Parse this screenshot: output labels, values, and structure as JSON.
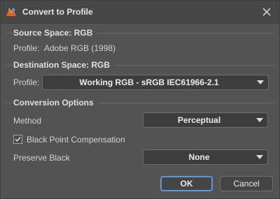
{
  "window": {
    "title": "Convert to Profile",
    "icon": "app-logo-icon",
    "close_icon": "close-icon"
  },
  "source": {
    "heading": "Source Space: RGB",
    "profile_label": "Profile:",
    "profile_value": "Adobe RGB (1998)"
  },
  "destination": {
    "heading": "Destination Space: RGB",
    "profile_label": "Profile:",
    "profile_value": "Working RGB - sRGB IEC61966-2.1"
  },
  "conversion": {
    "heading": "Conversion Options",
    "method_label": "Method",
    "method_value": "Perceptual",
    "black_point_label": "Black Point Compensation",
    "black_point_checked": true,
    "preserve_black_label": "Preserve Black",
    "preserve_black_value": "None"
  },
  "buttons": {
    "ok": "OK",
    "cancel": "Cancel"
  },
  "colors": {
    "background": "#535353",
    "titlebar": "#474747",
    "accent": "#5e97d6",
    "field": "#3d3d3d"
  }
}
